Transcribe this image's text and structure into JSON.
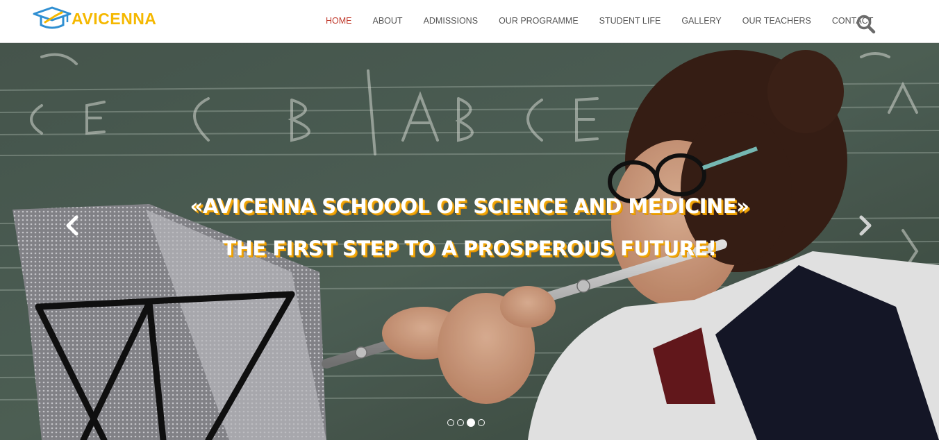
{
  "brand": {
    "name": "AVICENNA",
    "name_color": "#f5b800",
    "icon_color": "#2f8fd2",
    "icon": "graduation-cap-icon"
  },
  "nav": {
    "items": [
      {
        "label": "HOME",
        "active": true
      },
      {
        "label": "ABOUT",
        "active": false
      },
      {
        "label": "ADMISSIONS",
        "active": false
      },
      {
        "label": "OUR PROGRAMME",
        "active": false
      },
      {
        "label": "STUDENT LIFE",
        "active": false
      },
      {
        "label": "GALLERY",
        "active": false
      },
      {
        "label": "OUR TEACHERS",
        "active": false
      },
      {
        "label": "CONTACT",
        "active": false
      }
    ],
    "active_color": "#c0392b",
    "text_color": "#555555",
    "search_icon": "search-icon"
  },
  "hero": {
    "title": "«AVICENNA SCHOOOL OF SCIENCE AND MEDICINE»",
    "subtitle": "THE FIRST STEP TO A PROSPEROUS FUTURE!",
    "text_outline_color": "#f0a80a",
    "prev_icon": "chevron-left-icon",
    "next_icon": "chevron-right-icon",
    "slide_count": 4,
    "active_slide": 3
  }
}
